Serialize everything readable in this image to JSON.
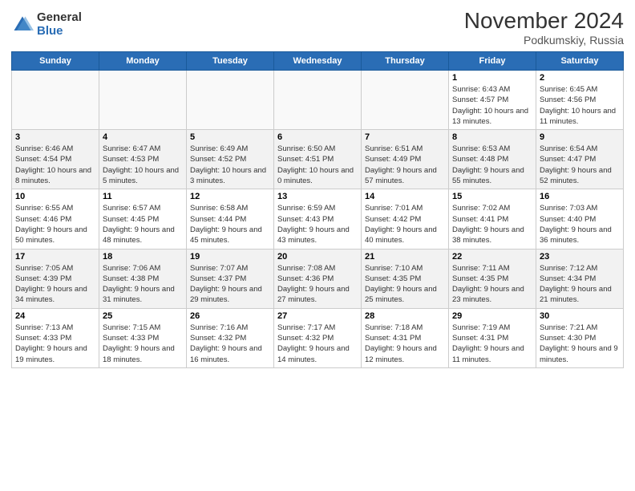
{
  "logo": {
    "general": "General",
    "blue": "Blue"
  },
  "title": "November 2024",
  "subtitle": "Podkumskiy, Russia",
  "days_header": [
    "Sunday",
    "Monday",
    "Tuesday",
    "Wednesday",
    "Thursday",
    "Friday",
    "Saturday"
  ],
  "weeks": [
    [
      {
        "day": "",
        "info": ""
      },
      {
        "day": "",
        "info": ""
      },
      {
        "day": "",
        "info": ""
      },
      {
        "day": "",
        "info": ""
      },
      {
        "day": "",
        "info": ""
      },
      {
        "day": "1",
        "info": "Sunrise: 6:43 AM\nSunset: 4:57 PM\nDaylight: 10 hours and 13 minutes."
      },
      {
        "day": "2",
        "info": "Sunrise: 6:45 AM\nSunset: 4:56 PM\nDaylight: 10 hours and 11 minutes."
      }
    ],
    [
      {
        "day": "3",
        "info": "Sunrise: 6:46 AM\nSunset: 4:54 PM\nDaylight: 10 hours and 8 minutes."
      },
      {
        "day": "4",
        "info": "Sunrise: 6:47 AM\nSunset: 4:53 PM\nDaylight: 10 hours and 5 minutes."
      },
      {
        "day": "5",
        "info": "Sunrise: 6:49 AM\nSunset: 4:52 PM\nDaylight: 10 hours and 3 minutes."
      },
      {
        "day": "6",
        "info": "Sunrise: 6:50 AM\nSunset: 4:51 PM\nDaylight: 10 hours and 0 minutes."
      },
      {
        "day": "7",
        "info": "Sunrise: 6:51 AM\nSunset: 4:49 PM\nDaylight: 9 hours and 57 minutes."
      },
      {
        "day": "8",
        "info": "Sunrise: 6:53 AM\nSunset: 4:48 PM\nDaylight: 9 hours and 55 minutes."
      },
      {
        "day": "9",
        "info": "Sunrise: 6:54 AM\nSunset: 4:47 PM\nDaylight: 9 hours and 52 minutes."
      }
    ],
    [
      {
        "day": "10",
        "info": "Sunrise: 6:55 AM\nSunset: 4:46 PM\nDaylight: 9 hours and 50 minutes."
      },
      {
        "day": "11",
        "info": "Sunrise: 6:57 AM\nSunset: 4:45 PM\nDaylight: 9 hours and 48 minutes."
      },
      {
        "day": "12",
        "info": "Sunrise: 6:58 AM\nSunset: 4:44 PM\nDaylight: 9 hours and 45 minutes."
      },
      {
        "day": "13",
        "info": "Sunrise: 6:59 AM\nSunset: 4:43 PM\nDaylight: 9 hours and 43 minutes."
      },
      {
        "day": "14",
        "info": "Sunrise: 7:01 AM\nSunset: 4:42 PM\nDaylight: 9 hours and 40 minutes."
      },
      {
        "day": "15",
        "info": "Sunrise: 7:02 AM\nSunset: 4:41 PM\nDaylight: 9 hours and 38 minutes."
      },
      {
        "day": "16",
        "info": "Sunrise: 7:03 AM\nSunset: 4:40 PM\nDaylight: 9 hours and 36 minutes."
      }
    ],
    [
      {
        "day": "17",
        "info": "Sunrise: 7:05 AM\nSunset: 4:39 PM\nDaylight: 9 hours and 34 minutes."
      },
      {
        "day": "18",
        "info": "Sunrise: 7:06 AM\nSunset: 4:38 PM\nDaylight: 9 hours and 31 minutes."
      },
      {
        "day": "19",
        "info": "Sunrise: 7:07 AM\nSunset: 4:37 PM\nDaylight: 9 hours and 29 minutes."
      },
      {
        "day": "20",
        "info": "Sunrise: 7:08 AM\nSunset: 4:36 PM\nDaylight: 9 hours and 27 minutes."
      },
      {
        "day": "21",
        "info": "Sunrise: 7:10 AM\nSunset: 4:35 PM\nDaylight: 9 hours and 25 minutes."
      },
      {
        "day": "22",
        "info": "Sunrise: 7:11 AM\nSunset: 4:35 PM\nDaylight: 9 hours and 23 minutes."
      },
      {
        "day": "23",
        "info": "Sunrise: 7:12 AM\nSunset: 4:34 PM\nDaylight: 9 hours and 21 minutes."
      }
    ],
    [
      {
        "day": "24",
        "info": "Sunrise: 7:13 AM\nSunset: 4:33 PM\nDaylight: 9 hours and 19 minutes."
      },
      {
        "day": "25",
        "info": "Sunrise: 7:15 AM\nSunset: 4:33 PM\nDaylight: 9 hours and 18 minutes."
      },
      {
        "day": "26",
        "info": "Sunrise: 7:16 AM\nSunset: 4:32 PM\nDaylight: 9 hours and 16 minutes."
      },
      {
        "day": "27",
        "info": "Sunrise: 7:17 AM\nSunset: 4:32 PM\nDaylight: 9 hours and 14 minutes."
      },
      {
        "day": "28",
        "info": "Sunrise: 7:18 AM\nSunset: 4:31 PM\nDaylight: 9 hours and 12 minutes."
      },
      {
        "day": "29",
        "info": "Sunrise: 7:19 AM\nSunset: 4:31 PM\nDaylight: 9 hours and 11 minutes."
      },
      {
        "day": "30",
        "info": "Sunrise: 7:21 AM\nSunset: 4:30 PM\nDaylight: 9 hours and 9 minutes."
      }
    ]
  ]
}
